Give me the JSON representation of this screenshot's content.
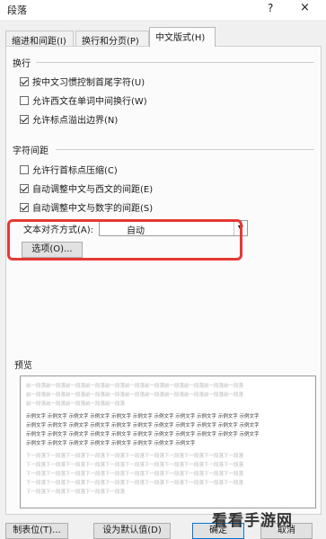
{
  "window": {
    "title": "段落",
    "help": "?",
    "close": "×"
  },
  "tabs": [
    {
      "label": "缩进和间距(I)"
    },
    {
      "label": "换行和分页(P)"
    },
    {
      "label": "中文版式(H)"
    }
  ],
  "line_break": {
    "heading": "换行",
    "options": [
      {
        "label": "按中文习惯控制首尾字符(U)",
        "checked": true
      },
      {
        "label": "允许西文在单词中间换行(W)",
        "checked": false
      },
      {
        "label": "允许标点溢出边界(N)",
        "checked": true
      }
    ]
  },
  "char_spacing": {
    "heading": "字符间距",
    "options": [
      {
        "label": "允许行首标点压缩(C)",
        "checked": false
      },
      {
        "label": "自动调整中文与西文的间距(E)",
        "checked": true
      },
      {
        "label": "自动调整中文与数字的间距(S)",
        "checked": true
      }
    ],
    "align_label": "文本对齐方式(A):",
    "align_value": "自动",
    "options_button": "选项(O)..."
  },
  "preview": {
    "heading": "预览",
    "lines": [
      {
        "text": "前一段落前一段落前一段落前一段落前一段落前一段落前一段落前一段落前一段落前一段落前一段落",
        "style": "gray"
      },
      {
        "text": "前一段落前一段落前一段落前一段落前一段落前一段落前一段落前一段落前一段落前一段落前一段落",
        "style": "gray"
      },
      {
        "text": "前一段落前一段落前一段落前一段落前一段落",
        "style": "gray"
      },
      {
        "text": "示例文字 示例文字 示例文字 示例文字 示例文字 示例文字 示例文字 示例文字 示例文字 示例文字 示例文字",
        "style": "dark"
      },
      {
        "text": "示例文字 示例文字 示例文字 示例文字 示例文字 示例文字 示例文字 示例文字 示例文字 示例文字 示例文字",
        "style": "dark"
      },
      {
        "text": "示例文字 示例文字 示例文字 示例文字 示例文字 示例文字 示例文字 示例文字 示例文字 示例文字 示例文字",
        "style": "dark"
      },
      {
        "text": "示例文字 示例文字 示例文字 示例文字 示例文字 示例文字 示例文字 示例文字",
        "style": "dark"
      },
      {
        "text": "下一段落下一段落下一段落下一段落下一段落下一段落下一段落下一段落下一段落下一段落下一段落",
        "style": "gray"
      },
      {
        "text": "下一段落下一段落下一段落下一段落下一段落下一段落下一段落下一段落下一段落下一段落下一段落",
        "style": "gray"
      },
      {
        "text": "下一段落下一段落下一段落下一段落下一段落下一段落下一段落下一段落下一段落下一段落下一段落",
        "style": "gray"
      },
      {
        "text": "下一段落下一段落下一段落下一段落下一段落下一段落下一段落下一段落下一段落下一段落下一段落",
        "style": "gray"
      },
      {
        "text": "下一段落下一段落下一段落下一段落下一段落",
        "style": "gray"
      }
    ]
  },
  "footer": {
    "tabs_button": "制表位(T)...",
    "default_button": "设为默认值(D)",
    "ok_button": "确定",
    "cancel_button": "取消"
  },
  "watermark": "看看手游网"
}
